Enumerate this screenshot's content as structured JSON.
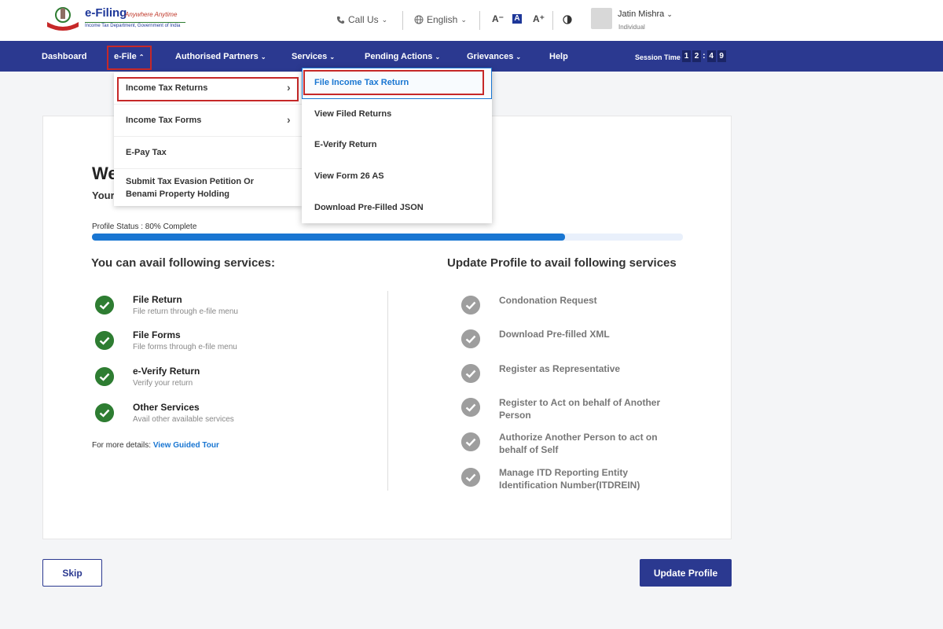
{
  "header": {
    "logo_title": "e-Filing",
    "logo_tagline": "Anywhere Anytime",
    "logo_subtitle": "Income Tax Department, Government of India",
    "call_us": "Call Us",
    "language": "English",
    "font_decrease": "A⁻",
    "font_normal": "A",
    "font_increase": "A⁺",
    "user_name": "Jatin Mishra",
    "user_role": "Individual"
  },
  "nav": {
    "items": [
      "Dashboard",
      "e-File",
      "Authorised Partners",
      "Services",
      "Pending Actions",
      "Grievances",
      "Help"
    ],
    "session_label": "Session Time",
    "session_digits": [
      "1",
      "2",
      "4",
      "9"
    ]
  },
  "efile_menu": {
    "items": [
      "Income Tax Returns",
      "Income Tax Forms",
      "E-Pay Tax",
      "Submit Tax Evasion Petition Or Benami Property Holding"
    ]
  },
  "itr_submenu": {
    "items": [
      "File Income Tax Return",
      "View Filed Returns",
      "E-Verify Return",
      "View Form 26 AS",
      "Download Pre-Filled JSON"
    ]
  },
  "card": {
    "welcome": "We",
    "welcome_sub": "Your",
    "profile_status": "Profile Status : 80% Complete",
    "profile_progress": 0.8,
    "avail_heading": "You can avail following services:",
    "update_heading": "Update Profile to avail following services",
    "services": [
      {
        "title": "File Return",
        "desc": "File return through e-file menu"
      },
      {
        "title": "File Forms",
        "desc": "File forms through e-file menu"
      },
      {
        "title": "e-Verify Return",
        "desc": "Verify your return"
      },
      {
        "title": "Other Services",
        "desc": "Avail other available services"
      }
    ],
    "more_details": "For more details:",
    "guided_tour": "View Guided Tour",
    "update_services": [
      "Condonation Request",
      "Download Pre-filled XML",
      "Register as Representative",
      "Register to Act on behalf of Another Person",
      "Authorize Another Person to act on behalf of Self",
      "Manage ITD Reporting Entity Identification Number(ITDREIN)"
    ]
  },
  "buttons": {
    "skip": "Skip",
    "update_profile": "Update Profile"
  },
  "colors": {
    "nav_bg": "#2b3990",
    "highlight_border": "#c62828",
    "check_green": "#2e7d32",
    "link_blue": "#1976d2"
  }
}
